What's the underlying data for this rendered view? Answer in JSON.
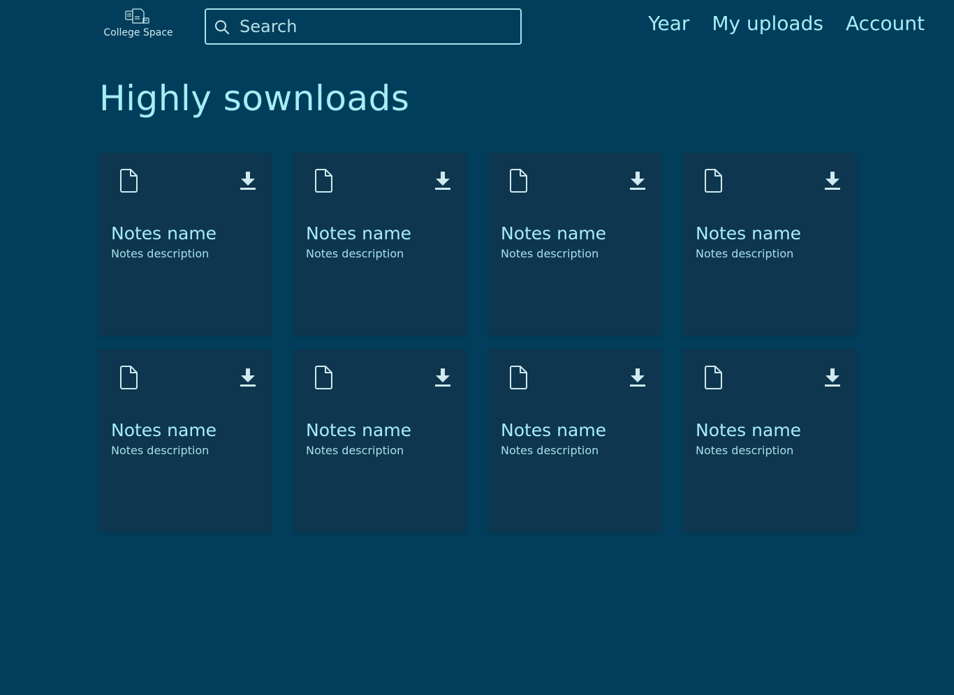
{
  "brand": {
    "name": "College Space",
    "icon": "books-logo-icon"
  },
  "search": {
    "placeholder": "Search",
    "value": "",
    "icon": "search-icon"
  },
  "nav": {
    "items": [
      {
        "label": "Year"
      },
      {
        "label": "My uploads"
      },
      {
        "label": "Account"
      }
    ]
  },
  "page": {
    "title": "Highly sownloads"
  },
  "notes": [
    {
      "name": "Notes name",
      "description": "Notes description"
    },
    {
      "name": "Notes name",
      "description": "Notes description"
    },
    {
      "name": "Notes name",
      "description": "Notes description"
    },
    {
      "name": "Notes name",
      "description": "Notes description"
    },
    {
      "name": "Notes name",
      "description": "Notes description"
    },
    {
      "name": "Notes name",
      "description": "Notes description"
    },
    {
      "name": "Notes name",
      "description": "Notes description"
    },
    {
      "name": "Notes name",
      "description": "Notes description"
    }
  ],
  "colors": {
    "background": "#023e5b",
    "card": "#0e364e",
    "accent": "#a6eef6"
  }
}
